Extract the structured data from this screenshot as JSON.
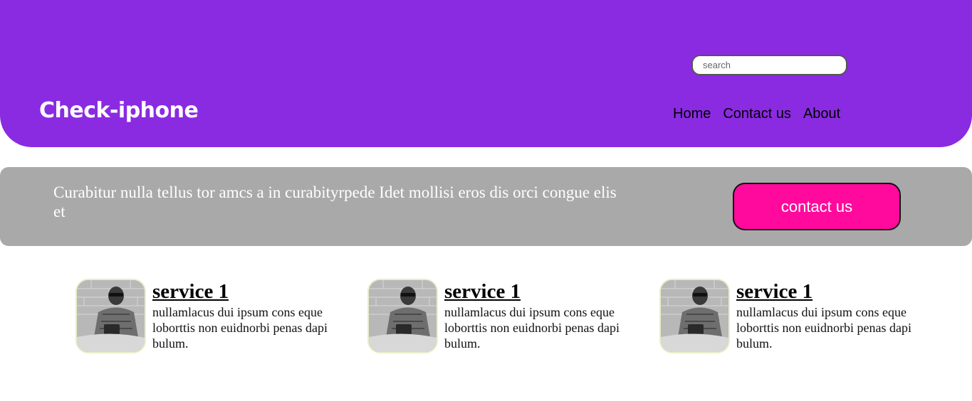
{
  "header": {
    "brand": "Check-iphone",
    "search": {
      "placeholder": "search",
      "value": ""
    },
    "nav": [
      "Home",
      "Contact us",
      "About"
    ],
    "background_color": "#8a2be2"
  },
  "banner": {
    "text": "Curabitur nulla tellus tor amcs a in curabityrpede Idet mollisi eros dis orci congue elis et",
    "button_label": "contact us",
    "background_color": "#a9a9a9",
    "button_color": "#ff0a9c"
  },
  "services": [
    {
      "title": "service 1",
      "description": "nullamlacus dui ipsum cons eque loborttis non euidnorbi penas dapi bulum.",
      "image": "person-photo"
    },
    {
      "title": "service 1",
      "description": "nullamlacus dui ipsum cons eque loborttis non euidnorbi penas dapi bulum.",
      "image": "person-photo"
    },
    {
      "title": "service 1",
      "description": "nullamlacus dui ipsum cons eque loborttis non euidnorbi penas dapi bulum.",
      "image": "person-photo"
    }
  ]
}
